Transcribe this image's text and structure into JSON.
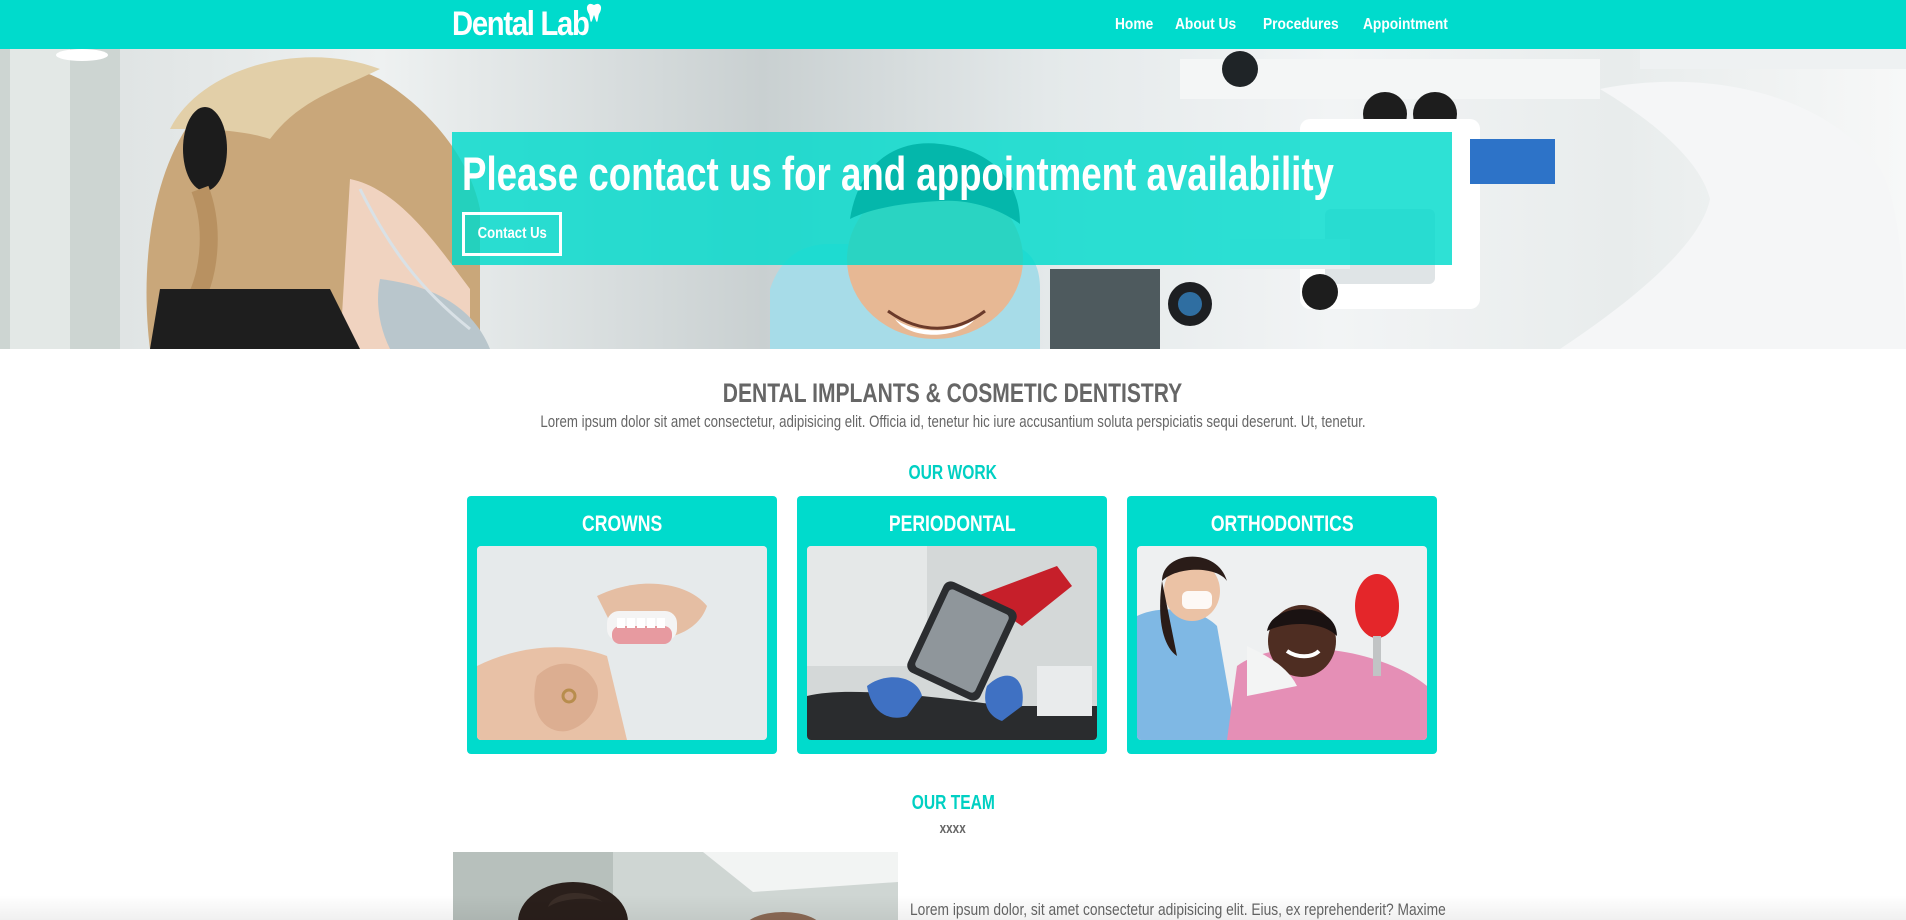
{
  "brand": {
    "name": "Dental Lab",
    "icon": "tooth-icon"
  },
  "nav": {
    "items": [
      {
        "label": "Home"
      },
      {
        "label": "About Us"
      },
      {
        "label": "Procedures"
      },
      {
        "label": "Appointment"
      }
    ]
  },
  "hero": {
    "title": "Please contact us for and appointment availability",
    "button_label": "Contact Us"
  },
  "intro": {
    "title": "DENTAL IMPLANTS & COSMETIC DENTISTRY",
    "text": "Lorem ipsum dolor sit amet consectetur, adipisicing elit. Officia id, tenetur hic iure accusantium soluta perspiciatis sequi deserunt. Ut, tenetur."
  },
  "work": {
    "heading": "OUR WORK",
    "cards": [
      {
        "title": "CROWNS"
      },
      {
        "title": "PERIODONTAL"
      },
      {
        "title": "ORTHODONTICS"
      }
    ]
  },
  "team": {
    "heading": "OUR TEAM",
    "subheading": "xxxx",
    "text": "Lorem ipsum dolor, sit amet consectetur adipisicing elit. Eius, ex reprehenderit? Maxime"
  },
  "colors": {
    "accent": "#00dbcc",
    "text": "#666666",
    "white": "#ffffff"
  }
}
